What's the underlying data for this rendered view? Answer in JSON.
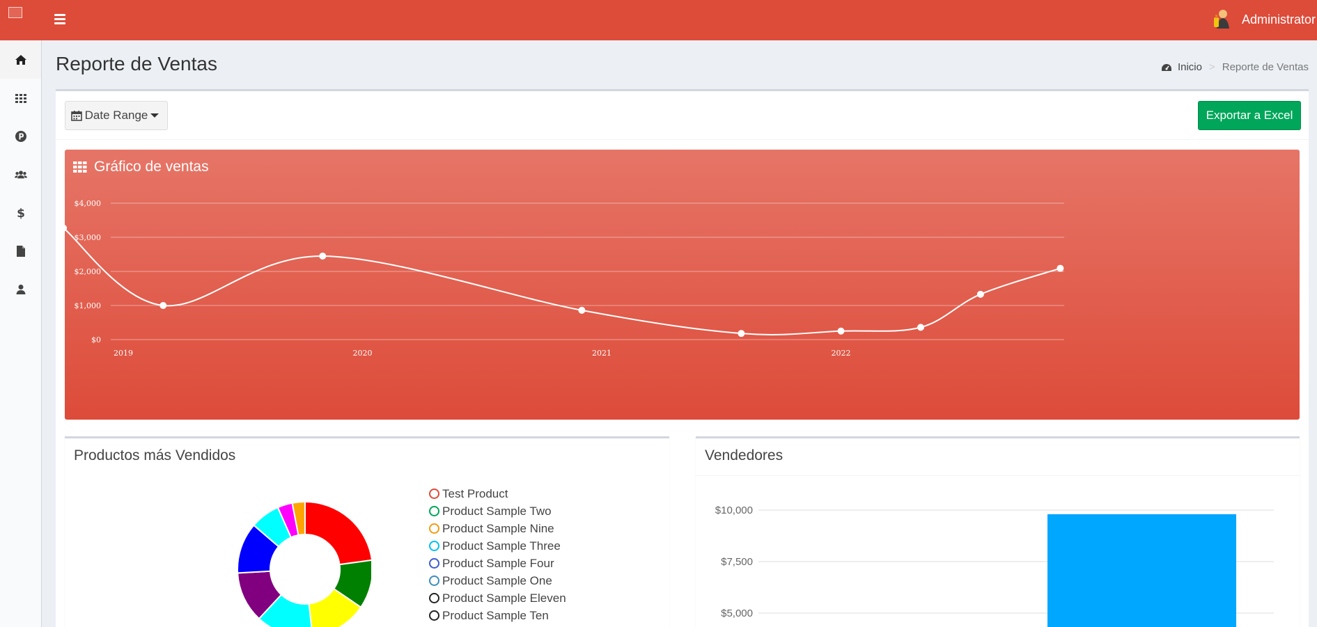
{
  "header": {
    "user_name": "Administrator"
  },
  "sidebar": {
    "items": [
      {
        "icon": "home-icon"
      },
      {
        "icon": "grid-icon"
      },
      {
        "icon": "product-p-icon"
      },
      {
        "icon": "users-icon"
      },
      {
        "icon": "dollar-icon"
      },
      {
        "icon": "file-icon"
      },
      {
        "icon": "user-icon"
      }
    ]
  },
  "page": {
    "title": "Reporte de Ventas",
    "breadcrumb": {
      "home": "Inicio",
      "separator": ">",
      "current": "Reporte de Ventas"
    }
  },
  "toolbar": {
    "date_range_label": "Date Range",
    "export_label": "Exportar a Excel"
  },
  "sales_chart": {
    "title": "Gráfico de ventas",
    "colors": {
      "background_top": "#e67567",
      "background_bottom": "#dd4b39",
      "line": "#ffffff"
    }
  },
  "top_products": {
    "title": "Productos más Vendidos",
    "legend": [
      {
        "label": "Test Product",
        "color": "#dd4b39"
      },
      {
        "label": "Product Sample Two",
        "color": "#00a65a"
      },
      {
        "label": "Product Sample Nine",
        "color": "#f39c12"
      },
      {
        "label": "Product Sample Three",
        "color": "#00c0ef"
      },
      {
        "label": "Product Sample Four",
        "color": "#3c5ccf"
      },
      {
        "label": "Product Sample One",
        "color": "#3c8dbc"
      },
      {
        "label": "Product Sample Eleven",
        "color": "#222222"
      },
      {
        "label": "Product Sample Ten",
        "color": "#222222"
      }
    ]
  },
  "sellers": {
    "title": "Vendedores",
    "bar_color": "#00a7ff"
  },
  "chart_data": [
    {
      "type": "line",
      "title": "Gráfico de ventas",
      "x_ticks": [
        "2019",
        "2020",
        "2021",
        "2022"
      ],
      "y_ticks": [
        "$0",
        "$1,000",
        "$2,000",
        "$3,000",
        "$4,000"
      ],
      "ylim": [
        0,
        4000
      ],
      "xlim": [
        "2019-01",
        "2023-01"
      ],
      "grid": true,
      "series": [
        {
          "points": [
            {
              "x": "2018-10",
              "y": 3270
            },
            {
              "x": "2019-03",
              "y": 1000
            },
            {
              "x": "2019-11",
              "y": 2450
            },
            {
              "x": "2020-12",
              "y": 860
            },
            {
              "x": "2021-08",
              "y": 180
            },
            {
              "x": "2022-01",
              "y": 250
            },
            {
              "x": "2022-05",
              "y": 360
            },
            {
              "x": "2022-08",
              "y": 1330
            },
            {
              "x": "2022-12",
              "y": 2090
            }
          ]
        }
      ]
    },
    {
      "type": "pie",
      "title": "Productos más Vendidos",
      "slices": [
        {
          "value": 22.5,
          "color": "#ff0000"
        },
        {
          "value": 11.5,
          "color": "#008000"
        },
        {
          "value": 13.5,
          "color": "#ffff00"
        },
        {
          "value": 13.5,
          "color": "#00ffff"
        },
        {
          "value": 12.0,
          "color": "#800080"
        },
        {
          "value": 12.0,
          "color": "#0000ff"
        },
        {
          "value": 7.0,
          "color": "#00ffff"
        },
        {
          "value": 3.5,
          "color": "#ff00ff"
        },
        {
          "value": 3.0,
          "color": "#ffa500"
        }
      ]
    },
    {
      "type": "bar",
      "title": "Vendedores",
      "y_ticks": [
        "$5,000",
        "$7,500",
        "$10,000"
      ],
      "ylim": [
        5000,
        10000
      ],
      "values": [
        9800
      ],
      "grid": true
    }
  ]
}
